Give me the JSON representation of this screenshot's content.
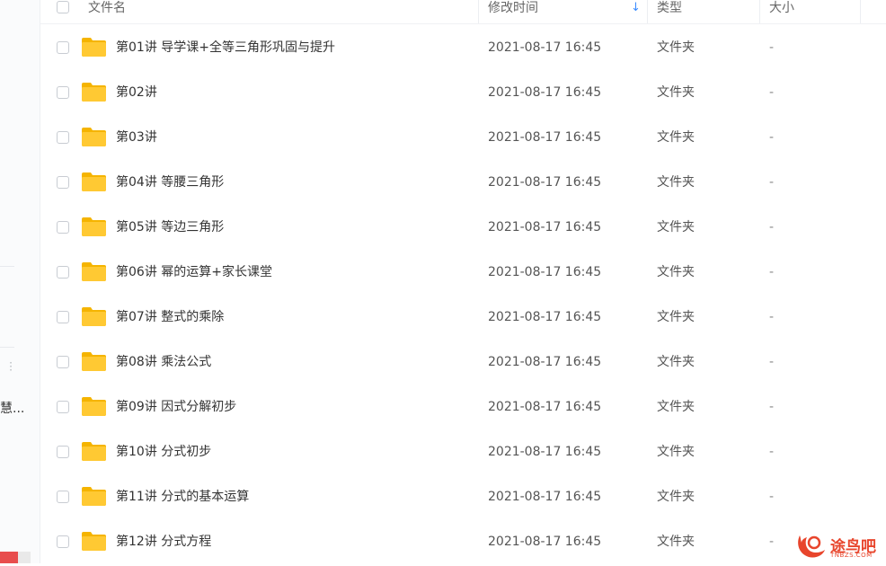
{
  "sidebar": {
    "truncated_label": "慧..."
  },
  "header": {
    "name": "文件名",
    "modified": "修改时间",
    "type": "类型",
    "size": "大小"
  },
  "files": [
    {
      "name": "第01讲 导学课+全等三角形巩固与提升",
      "modified": "2021-08-17 16:45",
      "type": "文件夹",
      "size": "-"
    },
    {
      "name": "第02讲",
      "modified": "2021-08-17 16:45",
      "type": "文件夹",
      "size": "-"
    },
    {
      "name": "第03讲",
      "modified": "2021-08-17 16:45",
      "type": "文件夹",
      "size": "-"
    },
    {
      "name": "第04讲 等腰三角形",
      "modified": "2021-08-17 16:45",
      "type": "文件夹",
      "size": "-"
    },
    {
      "name": "第05讲 等边三角形",
      "modified": "2021-08-17 16:45",
      "type": "文件夹",
      "size": "-"
    },
    {
      "name": "第06讲 幂的运算+家长课堂",
      "modified": "2021-08-17 16:45",
      "type": "文件夹",
      "size": "-"
    },
    {
      "name": "第07讲 整式的乘除",
      "modified": "2021-08-17 16:45",
      "type": "文件夹",
      "size": "-"
    },
    {
      "name": "第08讲 乘法公式",
      "modified": "2021-08-17 16:45",
      "type": "文件夹",
      "size": "-"
    },
    {
      "name": "第09讲 因式分解初步",
      "modified": "2021-08-17 16:45",
      "type": "文件夹",
      "size": "-"
    },
    {
      "name": "第10讲 分式初步",
      "modified": "2021-08-17 16:45",
      "type": "文件夹",
      "size": "-"
    },
    {
      "name": "第11讲 分式的基本运算",
      "modified": "2021-08-17 16:45",
      "type": "文件夹",
      "size": "-"
    },
    {
      "name": "第12讲 分式方程",
      "modified": "2021-08-17 16:45",
      "type": "文件夹",
      "size": "-"
    }
  ],
  "watermark": {
    "text": "途鸟吧",
    "sub": "TNBZS.COM"
  },
  "colors": {
    "folder": "#ffc933",
    "folder_tab": "#f5b400",
    "sort_accent": "#3b8cff",
    "watermark": "#e8452c"
  },
  "icons": {
    "folder": "folder-icon",
    "sort": "sort-down-arrow-icon"
  }
}
